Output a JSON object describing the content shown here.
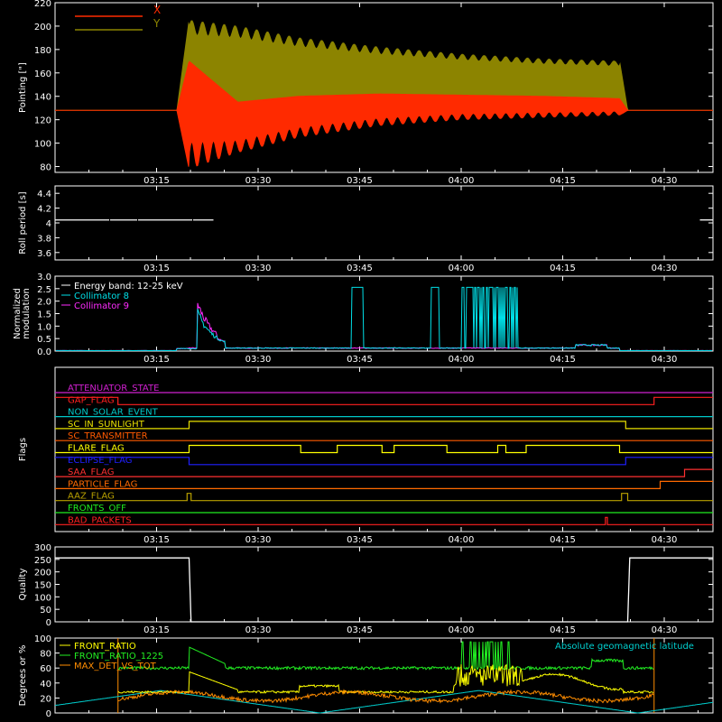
{
  "colors": {
    "bg": "#000000",
    "axis": "#ffffff",
    "x": "#ff2a00",
    "y": "#8c8400",
    "band": "#ffffff",
    "c8": "#00e0e8",
    "c9": "#ff2bff",
    "quality": "#ffffff",
    "front_ratio": "#ffff00",
    "front_ratio_1225": "#22ee22",
    "max_det": "#ff8c00",
    "geomag": "#00d0d0"
  },
  "time_axis": {
    "range_min": [
      3,
      61
    ],
    "tick_labels": [
      "03:15",
      "03:30",
      "03:45",
      "04:00",
      "04:15",
      "04:30"
    ]
  },
  "chart_data": [
    {
      "type": "line",
      "id": "pointing",
      "ylabel": "Pointing [\"]",
      "ylim": [
        75,
        220
      ],
      "yticks": [
        80,
        100,
        120,
        140,
        160,
        180,
        200,
        220
      ],
      "legend": [
        "X",
        "Y"
      ],
      "series": [
        {
          "name": "X",
          "description": "oscillating red band",
          "t": [
            3.0,
            3.3,
            3.33,
            3.45,
            3.6,
            3.8,
            4.0,
            4.2,
            4.39,
            4.41,
            4.62
          ],
          "lo": [
            128,
            128,
            78,
            92,
            105,
            115,
            120,
            122,
            124,
            128,
            128
          ],
          "hi": [
            128,
            128,
            170,
            135,
            140,
            142,
            141,
            140,
            138,
            128,
            128
          ]
        },
        {
          "name": "Y",
          "description": "oscillating olive band",
          "t": [
            3.0,
            3.3,
            3.33,
            3.45,
            3.6,
            3.8,
            4.0,
            4.2,
            4.39,
            4.41,
            4.62
          ],
          "lo": [
            128,
            128,
            100,
            115,
            125,
            130,
            133,
            134,
            133,
            128,
            128
          ],
          "hi": [
            128,
            128,
            205,
            200,
            190,
            182,
            176,
            172,
            170,
            128,
            128
          ]
        }
      ]
    },
    {
      "type": "line",
      "id": "roll",
      "ylabel": "Roll period [s]",
      "ylim": [
        3.5,
        4.5
      ],
      "yticks": [
        3.6,
        3.8,
        4.0,
        4.2,
        4.4
      ],
      "series": [
        {
          "name": "",
          "t": [
            3.0,
            3.36,
            3.39,
            4.41,
            4.5,
            4.62
          ],
          "v": [
            4.04,
            4.04,
            4.04,
            4.04,
            4.04,
            4.04
          ],
          "gap": [
            3.39,
            4.41
          ]
        }
      ]
    },
    {
      "type": "line",
      "id": "modulation",
      "ylabel": [
        "Normalized",
        "modulation"
      ],
      "ylim": [
        0,
        3.0
      ],
      "yticks": [
        "0.0",
        "0.5",
        "1.0",
        "1.5",
        "2.0",
        "2.5",
        "3.0"
      ],
      "legend": [
        "Energy band: 12-25 keV",
        "Collimator 8",
        "Collimator 9"
      ]
    },
    {
      "type": "table",
      "id": "flags",
      "ylabel": "Flags",
      "rows": [
        {
          "name": "ATTENUATOR_STATE",
          "color": "#d020d0",
          "level": [
            [
              3.0,
              0
            ]
          ]
        },
        {
          "name": "GAP_FLAG",
          "color": "#ff2020",
          "level": [
            [
              3.0,
              1
            ],
            [
              3.155,
              0
            ],
            [
              4.475,
              1
            ]
          ]
        },
        {
          "name": "NON_SOLAR_EVENT",
          "color": "#00c8c8",
          "level": [
            [
              3.0,
              0
            ]
          ]
        },
        {
          "name": "SC_IN_SUNLIGHT",
          "color": "#e8e000",
          "level": [
            [
              3.0,
              0
            ],
            [
              3.33,
              1
            ],
            [
              4.405,
              0
            ]
          ]
        },
        {
          "name": "SC_TRANSMITTER",
          "color": "#ff5a00",
          "level": [
            [
              3.0,
              0
            ]
          ]
        },
        {
          "name": "FLARE_FLAG",
          "color": "#ffff00",
          "level": [
            [
              3.0,
              0
            ],
            [
              3.33,
              1
            ],
            [
              3.605,
              0
            ],
            [
              3.695,
              1
            ],
            [
              3.805,
              0
            ],
            [
              3.835,
              1
            ],
            [
              3.965,
              0
            ],
            [
              4.09,
              1
            ],
            [
              4.11,
              0
            ],
            [
              4.16,
              1
            ],
            [
              4.39,
              0
            ]
          ]
        },
        {
          "name": "ECLIPSE_FLAG",
          "color": "#2020ff",
          "level": [
            [
              3.0,
              1
            ],
            [
              3.33,
              0
            ],
            [
              4.405,
              1
            ]
          ]
        },
        {
          "name": "SAA_FLAG",
          "color": "#ff3030",
          "level": [
            [
              3.0,
              0
            ],
            [
              4.55,
              1
            ]
          ]
        },
        {
          "name": "PARTICLE_FLAG",
          "color": "#ff6a00",
          "level": [
            [
              3.0,
              0
            ],
            [
              4.49,
              1
            ]
          ]
        },
        {
          "name": "AAZ_FLAG",
          "color": "#b8a000",
          "level": [
            [
              3.0,
              0
            ],
            [
              3.325,
              1
            ],
            [
              3.335,
              0
            ],
            [
              4.395,
              1
            ],
            [
              4.41,
              0
            ]
          ]
        },
        {
          "name": "FRONTS_OFF",
          "color": "#20ee20",
          "level": [
            [
              3.0,
              0
            ]
          ]
        },
        {
          "name": "BAD_PACKETS",
          "color": "#ff2020",
          "level": [
            [
              3.0,
              0
            ],
            [
              4.355,
              1
            ],
            [
              4.36,
              0
            ]
          ]
        }
      ]
    },
    {
      "type": "line",
      "id": "quality",
      "ylabel": "Quality",
      "ylim": [
        0,
        300
      ],
      "yticks": [
        0,
        50,
        100,
        150,
        200,
        250,
        300
      ],
      "series": [
        {
          "name": "",
          "t": [
            3.0,
            3.33,
            3.335,
            4.41,
            4.415,
            4.62
          ],
          "v": [
            256,
            256,
            0,
            0,
            256,
            256
          ]
        }
      ]
    },
    {
      "type": "line",
      "id": "ratios",
      "ylabel": "Degrees or %",
      "ylim": [
        0,
        100
      ],
      "yticks": [
        0,
        20,
        40,
        60,
        80,
        100
      ],
      "legend": [
        "FRONT_RATIO",
        "FRONT_RATIO_1225",
        "MAX_DET_VS_TOT"
      ],
      "annotation": "Absolute geomagnetic latitude"
    }
  ]
}
